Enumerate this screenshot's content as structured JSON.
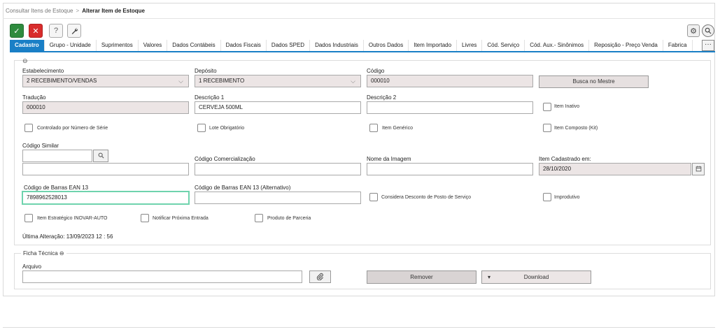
{
  "breadcrumb": {
    "parent": "Consultar Itens de Estoque",
    "separator": ">",
    "current": "Alterar Item de Estoque"
  },
  "toolbar": {
    "confirm_icon": "✓",
    "cancel_icon": "✕",
    "help_icon": "?",
    "tool_icon": "🔧",
    "gear_icon": "⚙",
    "search_icon": "⌕"
  },
  "tabs": [
    {
      "label": "Cadastro",
      "active": true
    },
    {
      "label": "Grupo - Unidade"
    },
    {
      "label": "Suprimentos"
    },
    {
      "label": "Valores"
    },
    {
      "label": "Dados Contábeis"
    },
    {
      "label": "Dados Fiscais"
    },
    {
      "label": "Dados SPED"
    },
    {
      "label": "Dados Industriais"
    },
    {
      "label": "Outros Dados"
    },
    {
      "label": "Item Importado"
    },
    {
      "label": "Livres"
    },
    {
      "label": "Cód. Serviço"
    },
    {
      "label": "Cód. Aux.- Sinônimos"
    },
    {
      "label": "Reposição - Preço Venda"
    },
    {
      "label": "Fabrica"
    }
  ],
  "tabs_more": "···",
  "form": {
    "collapse_icon": "⊖",
    "estabelecimento": {
      "label": "Estabelecimento",
      "value": "2 RECEBIMENTO/VENDAS"
    },
    "deposito": {
      "label": "Depósito",
      "value": "1 RECEBIMENTO"
    },
    "codigo": {
      "label": "Código",
      "value": "000010"
    },
    "busca_mestre": "Busca no Mestre",
    "traducao": {
      "label": "Tradução",
      "value": "000010"
    },
    "descricao1": {
      "label": "Descrição 1",
      "value": "CERVEJA 500ML"
    },
    "descricao2": {
      "label": "Descrição 2",
      "value": ""
    },
    "item_inativo": "Item Inativo",
    "controlado_serie": "Controlado por Número de Série",
    "lote_obrigatorio": "Lote Obrigatório",
    "item_generico": "Item Genérico",
    "item_composto": "Item Composto (Kit)",
    "codigo_similar": {
      "label": "Código Similar",
      "value": "",
      "desc": ""
    },
    "codigo_comercializacao": {
      "label": "Código Comercialização",
      "value": ""
    },
    "nome_imagem": {
      "label": "Nome da Imagem",
      "value": ""
    },
    "item_cadastrado": {
      "label": "Item Cadastrado em:",
      "value": "28/10/2020"
    },
    "ean13": {
      "label": "Código de Barras EAN 13",
      "value": "7898962528013"
    },
    "ean13_alt": {
      "label": "Código de Barras EAN 13 (Alternativo)",
      "value": ""
    },
    "considera_desconto": "Considera Desconto de Posto de Serviço",
    "improdutivo": "Improdutivo",
    "item_estrategico": "Item Estratégico INOVAR-AUTO",
    "notificar_entrada": "Notificar Próxima Entrada",
    "produto_parceria": "Produto de Parceria",
    "ultima_alteracao": "Última Alteração: 13/09/2023 12 : 56"
  },
  "ficha": {
    "legend": "Ficha Técnica",
    "collapse_icon": "⊖",
    "arquivo_label": "Arquivo",
    "arquivo_value": "",
    "attach_icon": "📎",
    "remover": "Remover",
    "download": "Download",
    "download_caret": "▾"
  }
}
